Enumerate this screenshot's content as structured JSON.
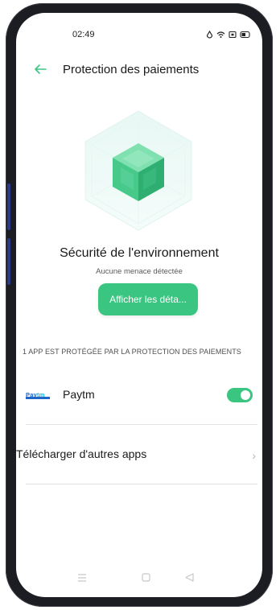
{
  "status_bar": {
    "time": "02:49"
  },
  "header": {
    "title": "Protection des paiements"
  },
  "environment": {
    "title": "Sécurité de l'environnement",
    "subtitle": "Aucune menace détectée",
    "details_button": "Afficher les déta..."
  },
  "section": {
    "header": "1 APP EST PROTÉGÉE PAR LA PROTECTION DES PAIEMENTS"
  },
  "apps": [
    {
      "name": "Paytm",
      "logo_text_a": "Pay",
      "logo_text_b": "tm",
      "protected": true
    }
  ],
  "actions": {
    "download_label": "Télécharger d'autres apps"
  },
  "colors": {
    "accent": "#3ac580",
    "text": "#1a1a1a",
    "muted": "#5a5a5a"
  },
  "nav": {
    "icons": [
      "menu-icon",
      "home-icon",
      "back-triangle-icon"
    ]
  }
}
